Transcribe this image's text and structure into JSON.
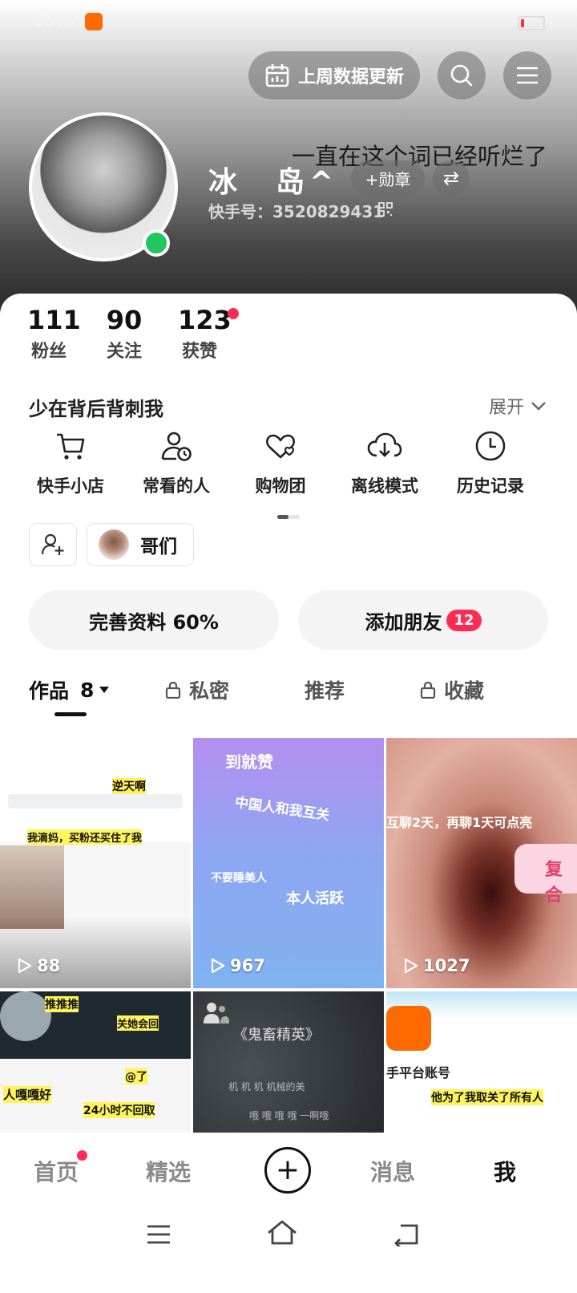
{
  "status_bar": {
    "time": "23:37"
  },
  "header": {
    "data_update_label": "上周数据更新",
    "overlay_text": "一直在这个词已经听烂了",
    "nickname": "冰　岛^",
    "medal_label": "+勋章",
    "kuaishou_id": "快手号：3520829431"
  },
  "stats": [
    {
      "value": "111",
      "label": "粉丝"
    },
    {
      "value": "90",
      "label": "关注"
    },
    {
      "value": "123",
      "label": "获赞"
    }
  ],
  "bio": {
    "text": "少在背后背刺我",
    "expand_label": "展开"
  },
  "tools": [
    {
      "label": "快手小店",
      "icon": "cart-icon"
    },
    {
      "label": "常看的人",
      "icon": "person-clock-icon"
    },
    {
      "label": "购物团",
      "icon": "heart-group-icon"
    },
    {
      "label": "离线模式",
      "icon": "cloud-download-icon"
    },
    {
      "label": "历史记录",
      "icon": "clock-icon"
    }
  ],
  "group": {
    "label": "哥们"
  },
  "actions": {
    "complete_profile": "完善资料 60%",
    "add_friends": "添加朋友",
    "add_friends_count": "12"
  },
  "tabs": {
    "works": "作品",
    "works_count": "8",
    "private": "私密",
    "recommend": "推荐",
    "favorites": "收藏"
  },
  "videos": [
    {
      "views": "88",
      "caption_1": "逆天啊",
      "caption_2": "我滴妈，买粉还买住了我"
    },
    {
      "views": "967",
      "caption_1": "到就赞",
      "caption_2": "中国人和我互关",
      "caption_3": "不要睡美人",
      "caption_4": "本人活跃"
    },
    {
      "views": "1027",
      "caption_1": "互聊2天，再聊1天可点亮",
      "caption_2": "复合"
    },
    {
      "caption_1": "推推推",
      "caption_2": "关她会回",
      "caption_3": "@了",
      "caption_4": "人嘎嘎好",
      "caption_5": "24小时不回取"
    },
    {
      "caption_1": "《鬼畜精英》",
      "caption_2": "机 机 机 机械的美",
      "caption_3": "哦 哦 哦 哦 一啊哦"
    },
    {
      "caption_1": "手平台账号",
      "caption_2": "他为了我取关了所有人"
    }
  ],
  "bottom_nav": {
    "home": "首页",
    "featured": "精选",
    "messages": "消息",
    "me": "我"
  },
  "colors": {
    "accent": "#fe2c55",
    "online": "#22c55e"
  }
}
